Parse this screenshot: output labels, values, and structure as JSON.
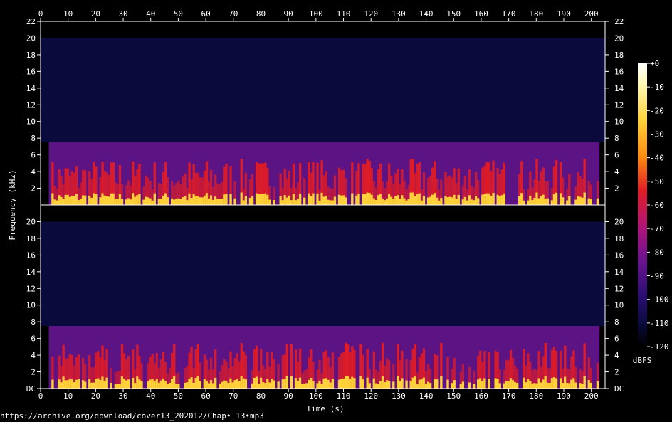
{
  "chart_data": {
    "type": "heatmap",
    "subtype": "spectrogram",
    "channels": 2,
    "xlabel": "Time (s)",
    "ylabel": "Frequency (kHz)",
    "x_range": [
      0,
      205
    ],
    "x_ticks": [
      "0",
      "10",
      "20",
      "30",
      "40",
      "50",
      "60",
      "70",
      "80",
      "90",
      "100",
      "110",
      "120",
      "130",
      "140",
      "150",
      "160",
      "170",
      "180",
      "190",
      "200"
    ],
    "y_range_khz": [
      0,
      22
    ],
    "y_ticks_top": [
      "2",
      "4",
      "6",
      "8",
      "10",
      "12",
      "14",
      "16",
      "18",
      "20",
      "22"
    ],
    "y_ticks_bottom": [
      "DC",
      "2",
      "4",
      "6",
      "8",
      "10",
      "12",
      "14",
      "16",
      "18",
      "20"
    ],
    "content_cutoff_khz": 7.5,
    "noise_floor_top_khz": 20,
    "signal_start_s": 3,
    "signal_end_s": 203,
    "colorbar": {
      "label": "dBFS",
      "range": [
        -120,
        0
      ],
      "ticks": [
        "+0",
        "-10",
        "-20",
        "-30",
        "-40",
        "-50",
        "-60",
        "-70",
        "-80",
        "-90",
        "-100",
        "-110",
        "-120"
      ]
    },
    "grid": false
  },
  "footer": {
    "source": "https://archive.org/download/cover13_202012/Chap• 13•mp3"
  },
  "colors": {
    "background": "#000000",
    "axis": "#ffffff",
    "noise_floor": "#0a0a3c",
    "band_base": "#5c1384",
    "energy_mid": "#e01c26",
    "energy_high": "#ffd23a"
  }
}
